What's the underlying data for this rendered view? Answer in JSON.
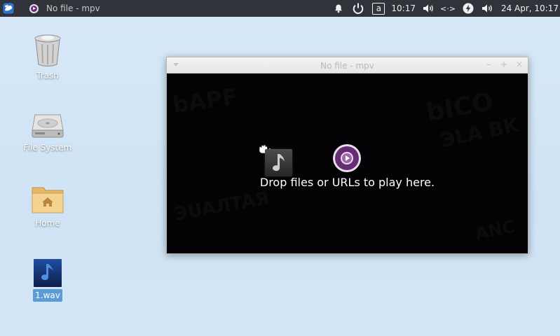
{
  "panel": {
    "task_title": "No file - mpv",
    "keyboard_layout": "a",
    "time": "10:17",
    "network_label": "<·>",
    "datetime": "24 Apr, 10:17"
  },
  "desktop": {
    "icons": [
      {
        "label": "Trash",
        "icon": "trash-icon"
      },
      {
        "label": "File System",
        "icon": "hard-drive-icon"
      },
      {
        "label": "Home",
        "icon": "home-folder-icon"
      },
      {
        "label": "1.wav",
        "icon": "audio-file-icon",
        "selected": true
      }
    ]
  },
  "window": {
    "title": "No file - mpv",
    "minimize_symbol": "–",
    "maximize_symbol": "+",
    "close_symbol": "×",
    "drop_text": "Drop files or URLs to play here."
  },
  "colors": {
    "panel_bg": "#30343a",
    "desktop_bg": "#cfe3f5",
    "video_bg": "#040204",
    "mpv_purple": "#672c73",
    "selection": "#5c9bd6"
  }
}
